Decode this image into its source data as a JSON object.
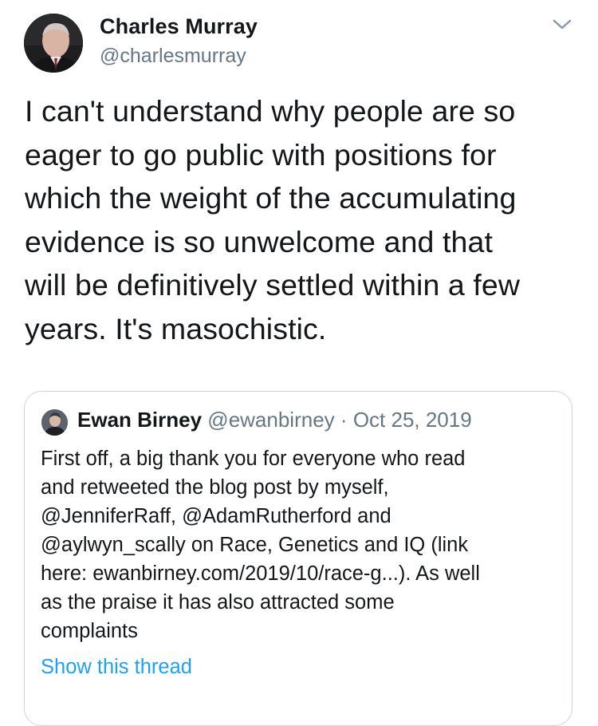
{
  "tweet": {
    "author_name": "Charles Murray",
    "author_handle": "@charlesmurray",
    "menu_icon": "chevron-down-icon",
    "text": "I can't understand why people are so\neager to go public with positions for\nwhich the weight of the accumulating\nevidence is so unwelcome and that\nwill be definitively settled within a few\nyears. It's masochistic."
  },
  "quoted_tweet": {
    "author_name": "Ewan Birney",
    "author_handle": "@ewanbirney",
    "separator": "·",
    "date": "Oct 25, 2019",
    "text": "First off, a big thank you for everyone who read\nand retweeted the blog post by myself,\n@JenniferRaff, @AdamRutherford and\n@aylwyn_scally on Race, Genetics and IQ (link\nhere: ewanbirney.com/2019/10/race-g...). As well\nas the praise it has also attracted some\ncomplaints",
    "show_thread_label": "Show this thread"
  },
  "colors": {
    "text_primary": "#14171a",
    "text_secondary": "#657786",
    "link": "#1da1f2",
    "border": "#ccd6dd"
  }
}
